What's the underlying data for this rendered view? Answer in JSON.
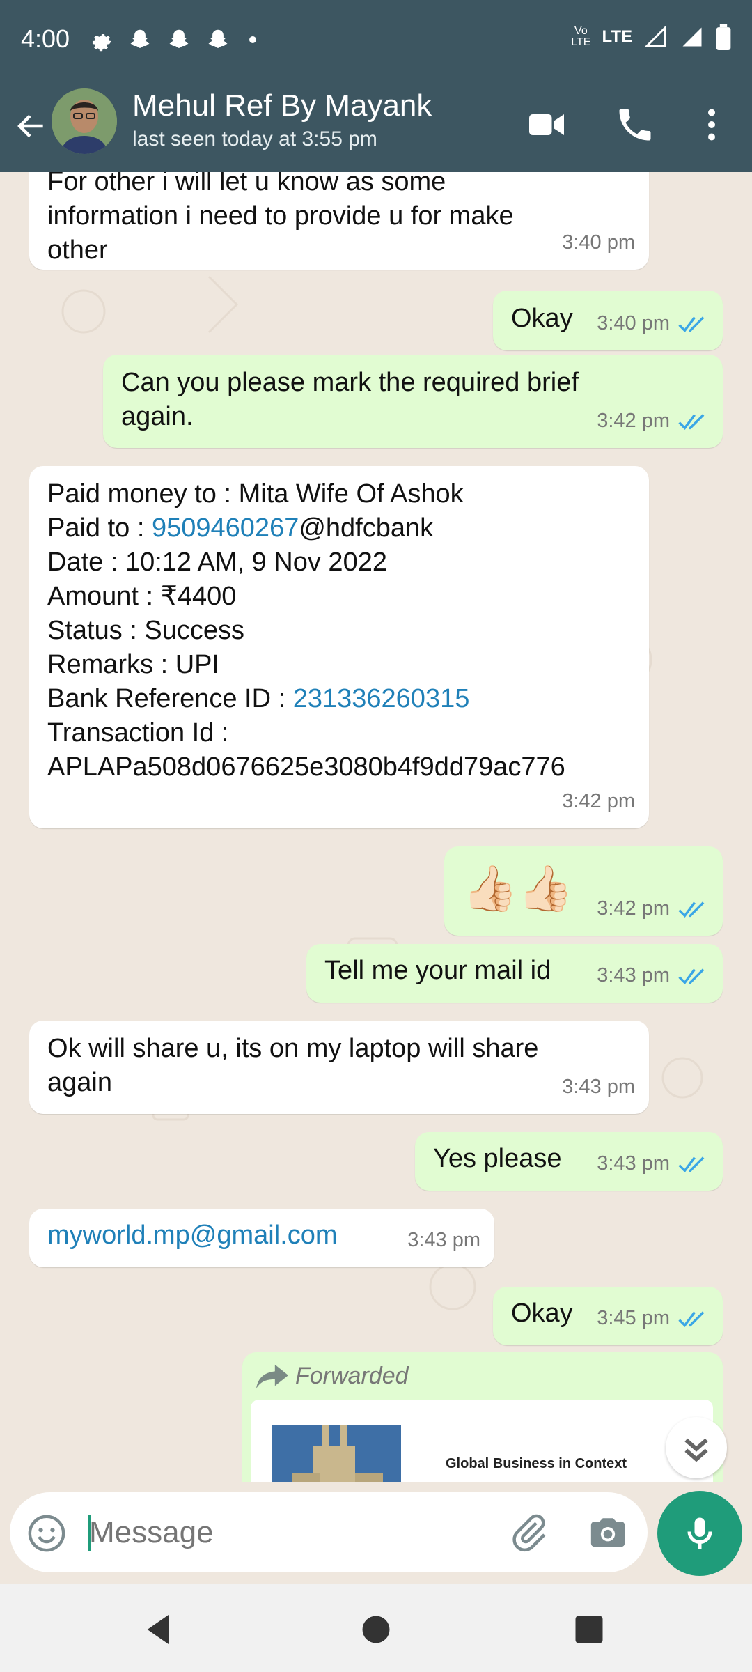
{
  "status_bar": {
    "time": "4:00",
    "network": "LTE"
  },
  "header": {
    "contact_name": "Mehul Ref By Mayank",
    "last_seen": "last seen today at 3:55 pm"
  },
  "messages": [
    {
      "text": "For other i will let u know as some\ninformation i need to provide u for make\nother",
      "time": "3:40 pm",
      "dir": "in"
    },
    {
      "text": "Okay",
      "time": "3:40 pm",
      "dir": "out"
    },
    {
      "text": "Can you please mark the required brief\nagain.",
      "time": "3:42 pm",
      "dir": "out"
    },
    {
      "lines": [
        "Paid money to : Mita Wife Of Ashok",
        "Paid to : ",
        "9509460267",
        "@hdfcbank",
        "Date : 10:12 AM, 9 Nov 2022",
        "Amount : ₹4400",
        "Status : Success",
        "Remarks : UPI",
        "Bank Reference ID : ",
        "231336260315",
        "Transaction Id :",
        "APLAPa508d0676625e3080b4f9dd79ac776"
      ],
      "time": "3:42 pm",
      "dir": "in"
    },
    {
      "text": "👍🏻👍🏻",
      "time": "3:42 pm",
      "dir": "out"
    },
    {
      "text": "Tell me your mail id",
      "time": "3:43 pm",
      "dir": "out"
    },
    {
      "text": "Ok will share u, its on my laptop will share\nagain",
      "time": "3:43 pm",
      "dir": "in"
    },
    {
      "text": "Yes please",
      "time": "3:43 pm",
      "dir": "out"
    },
    {
      "text": "myworld.mp@gmail.com",
      "time": "3:43 pm",
      "dir": "in"
    },
    {
      "text": "Okay",
      "time": "3:45 pm",
      "dir": "out"
    }
  ],
  "forwarded": {
    "label": "Forwarded",
    "preview_title": "Global Business in Context"
  },
  "composer": {
    "placeholder": "Message"
  },
  "colors": {
    "header": "#3d5661",
    "outgoing_bubble": "#e1fcd2",
    "incoming_bubble": "#ffffff",
    "accent": "#1f9c7a",
    "tick_blue": "#3aa6e6",
    "link": "#1f80b8"
  },
  "icons": [
    "gear-icon",
    "snapchat-icon",
    "back-arrow-icon",
    "video-call-icon",
    "phone-icon",
    "more-options-icon",
    "emoji-icon",
    "attach-icon",
    "camera-icon",
    "mic-icon",
    "scroll-down-icon",
    "nav-back-icon",
    "nav-home-icon",
    "nav-recents-icon"
  ]
}
